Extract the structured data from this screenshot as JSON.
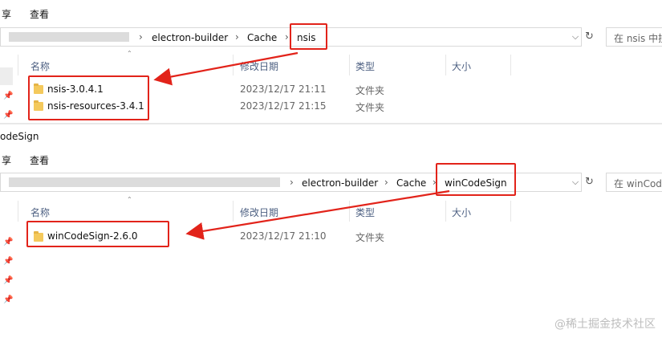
{
  "top": {
    "menu": [
      "享",
      "查看"
    ],
    "breadcrumb": [
      "electron-builder",
      "Cache",
      "nsis"
    ],
    "search_placeholder": "在 nsis 中搜",
    "columns": [
      "名称",
      "修改日期",
      "类型",
      "大小"
    ],
    "rows": [
      {
        "name": "nsis-3.0.4.1",
        "date": "2023/12/17 21:11",
        "type": "文件夹"
      },
      {
        "name": "nsis-resources-3.4.1",
        "date": "2023/12/17 21:15",
        "type": "文件夹"
      }
    ]
  },
  "bottom": {
    "window_title": "odeSign",
    "menu": [
      "享",
      "查看"
    ],
    "breadcrumb": [
      "electron-builder",
      "Cache",
      "winCodeSign"
    ],
    "search_placeholder": "在 winCode",
    "columns": [
      "名称",
      "修改日期",
      "类型",
      "大小"
    ],
    "rows": [
      {
        "name": "winCodeSign-2.6.0",
        "date": "2023/12/17 21:10",
        "type": "文件夹"
      }
    ]
  },
  "glyphs": {
    "separator": "›",
    "dropdown": "⌵",
    "refresh": "↻",
    "pin": "📌",
    "sort": "⌃"
  },
  "watermark": "@稀土掘金技术社区",
  "colors": {
    "highlight": "#e2231a",
    "folder": "#f4c95c"
  }
}
